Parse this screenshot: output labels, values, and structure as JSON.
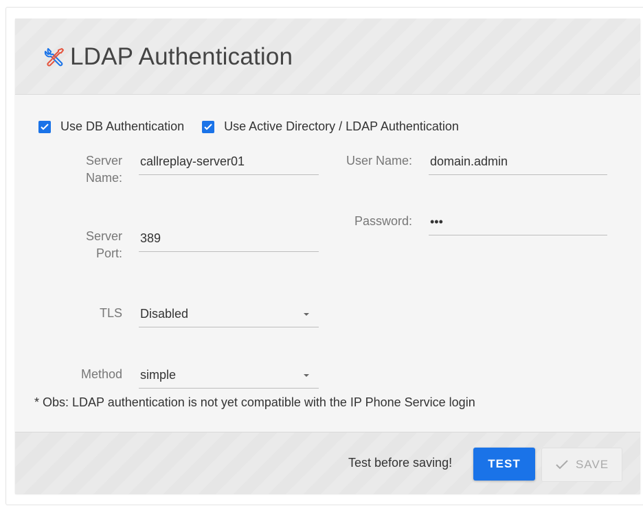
{
  "header": {
    "title": "LDAP Authentication",
    "icon": "tools-icon",
    "icon_color": "#1a73e8",
    "icon_accent": "#e5533d"
  },
  "options": {
    "use_db_auth": {
      "label": "Use DB Authentication",
      "checked": true
    },
    "use_ldap_auth": {
      "label": "Use Active Directory / LDAP Authentication",
      "checked": true
    }
  },
  "fields": {
    "server_name": {
      "label_line1": "Server",
      "label_line2": "Name:",
      "value": "callreplay-server01"
    },
    "server_port": {
      "label_line1": "Server",
      "label_line2": "Port:",
      "value": "389"
    },
    "tls": {
      "label": "TLS",
      "value": "Disabled"
    },
    "method": {
      "label": "Method",
      "value": "simple"
    },
    "user_name": {
      "label": "User Name:",
      "value": "domain.admin"
    },
    "password": {
      "label": "Password:",
      "value": "•••"
    }
  },
  "note": "* Obs: LDAP authentication is not yet compatible with the IP Phone Service login",
  "footer": {
    "hint": "Test before saving!",
    "test_label": "TEST",
    "save_label": "SAVE"
  },
  "colors": {
    "accent": "#1a73e8",
    "disabled_text": "#aaaaaa"
  }
}
